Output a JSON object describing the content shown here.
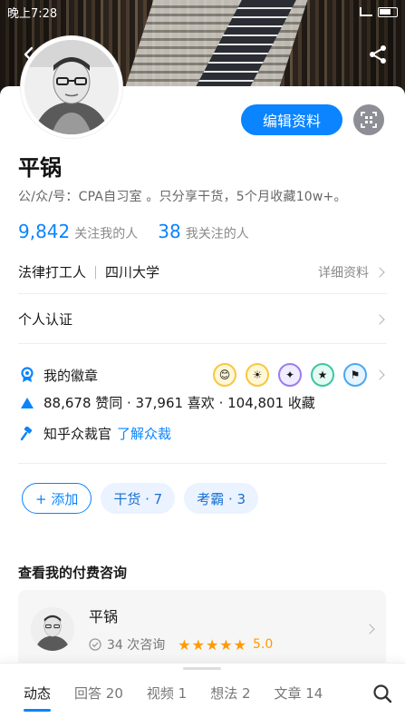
{
  "status_bar": {
    "time": "晚上7:28"
  },
  "profile": {
    "name": "平锅",
    "bio": "公/众/号：CPA自习室 。只分享干货，5个月收藏10w+。",
    "edit_label": "编辑资料",
    "followers": {
      "count": "9,842",
      "label": "关注我的人"
    },
    "following": {
      "count": "38",
      "label": "我关注的人"
    },
    "job": "法律打工人",
    "school": "四川大学",
    "details_label": "详细资料",
    "verify_label": "个人认证"
  },
  "badges": {
    "label": "我的徽章"
  },
  "stats": {
    "text": "88,678 赞同 · 37,961 喜欢 · 104,801 收藏"
  },
  "jury": {
    "label": "知乎众裁官",
    "link": "了解众裁"
  },
  "tags": {
    "add_label": "+ 添加",
    "items": [
      "干货 · 7",
      "考霸 · 3"
    ]
  },
  "consult": {
    "section_title": "查看我的付费咨询",
    "name": "平锅",
    "count": "34 次咨询",
    "stars": "★★★★★",
    "score": "5.0"
  },
  "tabs": [
    "动态",
    "回答 20",
    "视频 1",
    "想法 2",
    "文章 14"
  ],
  "colors": {
    "accent": "#0a84ff",
    "star": "#ff9a00"
  }
}
